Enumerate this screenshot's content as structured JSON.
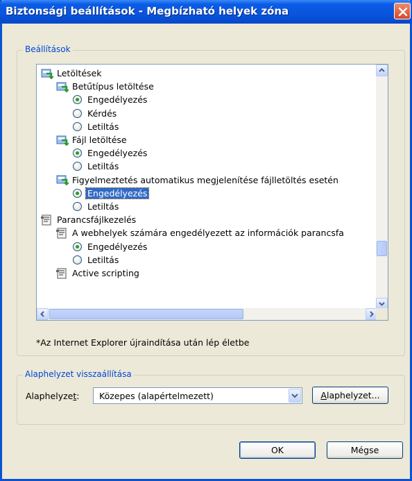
{
  "window": {
    "title": "Biztonsági beállítások - Megbízható helyek zóna"
  },
  "settings_group": {
    "legend": "Beállítások",
    "tree": [
      {
        "type": "category",
        "label": "Letöltések",
        "indent": 0
      },
      {
        "type": "category",
        "label": "Betűtípus letöltése",
        "indent": 1
      },
      {
        "type": "radio",
        "label": "Engedélyezés",
        "checked": true,
        "indent": 2
      },
      {
        "type": "radio",
        "label": "Kérdés",
        "checked": false,
        "indent": 2
      },
      {
        "type": "radio",
        "label": "Letiltás",
        "checked": false,
        "indent": 2
      },
      {
        "type": "category",
        "label": "Fájl letöltése",
        "indent": 1
      },
      {
        "type": "radio",
        "label": "Engedélyezés",
        "checked": true,
        "indent": 2
      },
      {
        "type": "radio",
        "label": "Letiltás",
        "checked": false,
        "indent": 2
      },
      {
        "type": "category",
        "label": "Figyelmeztetés automatikus megjelenítése fájlletöltés esetén",
        "indent": 1
      },
      {
        "type": "radio",
        "label": "Engedélyezés",
        "checked": true,
        "indent": 2,
        "selected": true
      },
      {
        "type": "radio",
        "label": "Letiltás",
        "checked": false,
        "indent": 2
      },
      {
        "type": "script-category",
        "label": "Parancsfájlkezelés",
        "indent": 0
      },
      {
        "type": "script-category",
        "label": "A webhelyek számára engedélyezett az információk parancsfa",
        "indent": 1
      },
      {
        "type": "radio",
        "label": "Engedélyezés",
        "checked": true,
        "indent": 2
      },
      {
        "type": "radio",
        "label": "Letiltás",
        "checked": false,
        "indent": 2
      },
      {
        "type": "script-category",
        "label": "Active scripting",
        "indent": 1
      }
    ],
    "note": "*Az Internet Explorer újraindítása után lép életbe"
  },
  "reset_group": {
    "legend": "Alaphelyzet visszaállítása",
    "label_prefix": "Alaphelyze",
    "label_accel": "t",
    "label_suffix": ":",
    "selected_value": "Közepes (alapértelmezett)",
    "reset_button_accel": "A",
    "reset_button_rest": "laphelyzet..."
  },
  "buttons": {
    "ok": "OK",
    "cancel": "Mégse"
  },
  "colors": {
    "title_bar": "#0a54dd",
    "selection": "#316ac5",
    "group_legend": "#0046d5"
  }
}
